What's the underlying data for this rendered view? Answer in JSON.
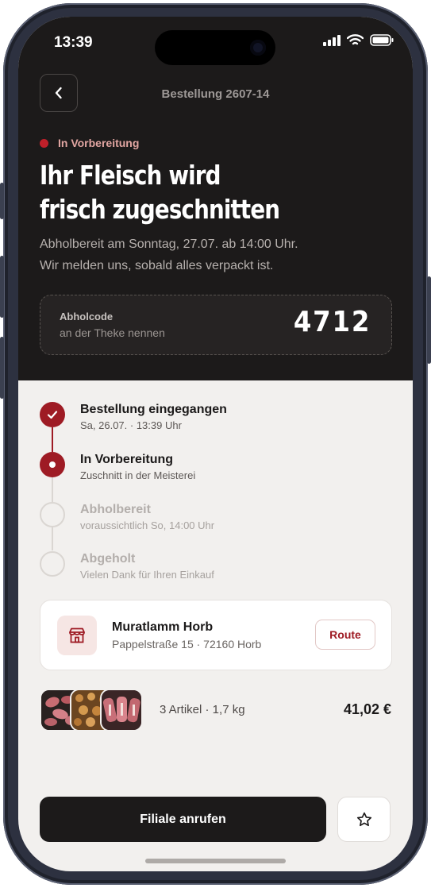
{
  "status_bar": {
    "time": "13:39"
  },
  "header": {
    "order_title": "Bestellung 2607-14"
  },
  "status": {
    "label": "In Vorbereitung",
    "color": "#c0202a"
  },
  "headline": {
    "line1": "Ihr Fleisch wird",
    "line2": "frisch zugeschnitten"
  },
  "subtitle": {
    "line1": "Abholbereit am Sonntag, 27.07. ab 14:00 Uhr.",
    "line2": "Wir melden uns, sobald alles verpackt ist."
  },
  "pickup_code": {
    "title": "Abholcode",
    "subtitle": "an der Theke nennen",
    "value": "4712"
  },
  "timeline": {
    "steps": [
      {
        "title": "Bestellung eingegangen",
        "subtitle": "Sa, 26.07. · 13:39 Uhr",
        "state": "done"
      },
      {
        "title": "In Vorbereitung",
        "subtitle": "Zuschnitt in der Meisterei",
        "state": "active"
      },
      {
        "title": "Abholbereit",
        "subtitle": "voraussichtlich So, 14:00 Uhr",
        "state": "pending"
      },
      {
        "title": "Abgeholt",
        "subtitle": "Vielen Dank für Ihren Einkauf",
        "state": "pending"
      }
    ]
  },
  "store": {
    "name": "Muratlamm Horb",
    "address": "Pappelstraße 15 · 72160 Horb",
    "route_label": "Route",
    "icon": "store-icon"
  },
  "order_summary": {
    "items": "3 Artikel · 1,7 kg",
    "total": "41,02 €"
  },
  "actions": {
    "call_label": "Filiale anrufen",
    "favorite_icon": "star-icon"
  },
  "colors": {
    "accent": "#9e1b24",
    "dark": "#1c1a1a",
    "background": "#f2f0ee"
  }
}
